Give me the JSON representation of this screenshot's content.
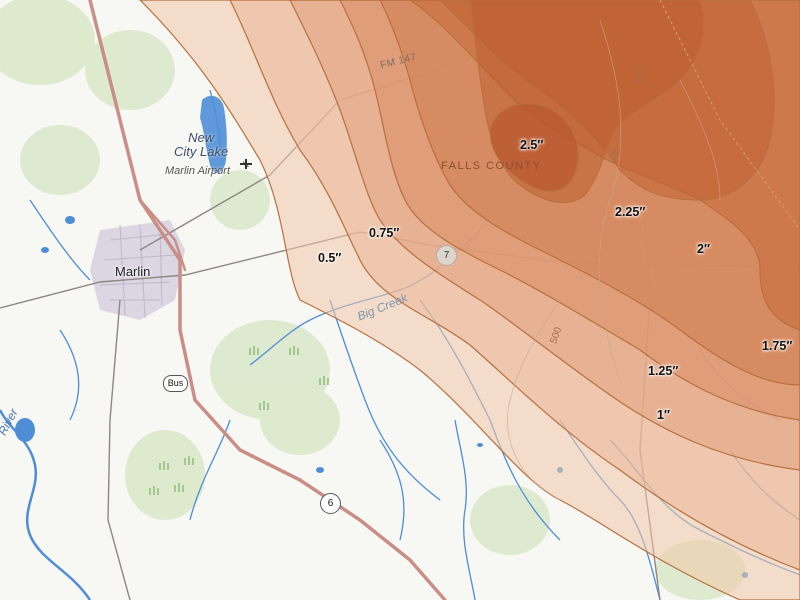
{
  "places": {
    "city": "Marlin",
    "lake": [
      "New",
      "City Lake"
    ],
    "airport": "Marlin Airport",
    "county": "FALLS COUNTY"
  },
  "roads": {
    "fm": "FM 147",
    "shield_6": "6",
    "shield_7": "7",
    "shield_bus": "Bus"
  },
  "water": {
    "creek": "Big Creek",
    "river": "River"
  },
  "contours": [
    "500",
    "500",
    "500"
  ],
  "rainfall": {
    "unit": "inches",
    "labels": {
      "v050": "0.5″",
      "v075": "0.75″",
      "v100": "1″",
      "v125": "1.25″",
      "v175": "1.75″",
      "v200": "2″",
      "v225": "2.25″",
      "v250": "2.5″"
    }
  },
  "colors": {
    "shade_light": "#f0c8a8",
    "shade_dark": "#c0602a",
    "isoline": "#b8703e",
    "highway": "#c98e86",
    "water": "#4e8ed6",
    "park": "#d6e6c6"
  }
}
